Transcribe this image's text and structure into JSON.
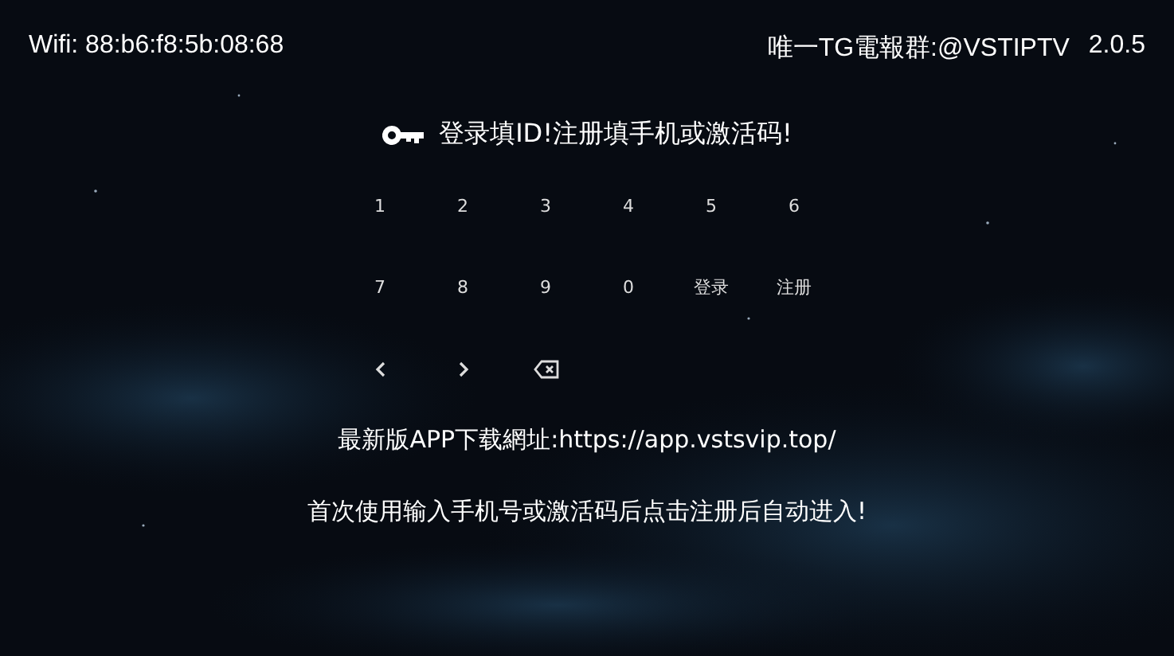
{
  "header": {
    "wifi": "Wifi: 88:b6:f8:5b:08:68",
    "channel": "唯一TG電報群:@VSTIPTV",
    "version": "2.0.5"
  },
  "title": "登录填ID!注册填手机或激活码!",
  "keypad": [
    {
      "kind": "text",
      "label": "1"
    },
    {
      "kind": "text",
      "label": "2"
    },
    {
      "kind": "text",
      "label": "3"
    },
    {
      "kind": "text",
      "label": "4"
    },
    {
      "kind": "text",
      "label": "5"
    },
    {
      "kind": "text",
      "label": "6"
    },
    {
      "kind": "text",
      "label": "7"
    },
    {
      "kind": "text",
      "label": "8"
    },
    {
      "kind": "text",
      "label": "9"
    },
    {
      "kind": "text",
      "label": "0"
    },
    {
      "kind": "text",
      "label": "登录"
    },
    {
      "kind": "text",
      "label": "注册"
    },
    {
      "kind": "left"
    },
    {
      "kind": "right"
    },
    {
      "kind": "backspace"
    }
  ],
  "download_note": "最新版APP下载網址:https://app.vstsvip.top/",
  "instruction": "首次使用输入手机号或激活码后点击注册后自动进入!"
}
